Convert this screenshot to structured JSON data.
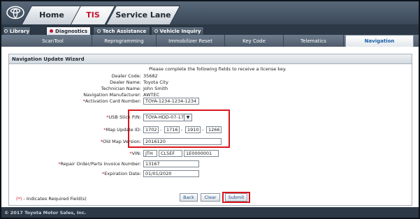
{
  "header": {
    "tabs": [
      {
        "label": "Home"
      },
      {
        "label": "TIS"
      },
      {
        "label": "Service Lane"
      }
    ]
  },
  "secondary_tabs": [
    {
      "label": "Library"
    },
    {
      "label": "Diagnostics"
    },
    {
      "label": "Tech Assistance"
    },
    {
      "label": "Vehicle Inquiry"
    }
  ],
  "sub_nav": [
    {
      "label": "ScanTool"
    },
    {
      "label": "Reprogramming"
    },
    {
      "label": "Immobilizer Reset"
    },
    {
      "label": "Key Code"
    },
    {
      "label": "Telematics"
    },
    {
      "label": "Navigation"
    }
  ],
  "wizard": {
    "title": "Navigation Update Wizard",
    "intro": "Please complete the following fields to receive a license key.",
    "dealer_code_label": "Dealer Code:",
    "dealer_code": "35682",
    "dealer_name_label": "Dealer Name:",
    "dealer_name": "Toyota City",
    "technician_label": "Technician Name:",
    "technician": "John Smith",
    "nav_mfr_label": "Navigation Manufacturer:",
    "nav_mfr": "AWTEC",
    "activation_label": "Activation Card Number:",
    "activation": "TOYA-1234-1234-1234",
    "usb_label": "USB Stick P/N:",
    "usb": "TOYA-HDD-07-17",
    "map_id_label": "Map Update ID:",
    "map_id": [
      "1702",
      "1716",
      "1910",
      "1266"
    ],
    "old_map_label": "Old Map Version:",
    "old_map": "2016120",
    "vin_label": "VIN:",
    "vin": [
      "JTH",
      "CL5EF",
      "1E0000001"
    ],
    "repair_label": "Repair Order/Parts Invoice Number:",
    "repair": "13167",
    "expiration_label": "Expiration Date:",
    "expiration": "01/01/2020",
    "required_note": "- Indicates Required Field(s)",
    "required_marker": "(*)",
    "asterisk": "*",
    "dash": "-",
    "buttons": {
      "back": "Back",
      "clear": "Clear",
      "submit": "Submit"
    }
  },
  "footer": {
    "text": "© 2017 Toyota Motor Sales, Inc."
  },
  "colors": {
    "accent_red": "#c8102e",
    "highlight_box": "#d9161d",
    "nav_active_text": "#1a5fa8"
  }
}
